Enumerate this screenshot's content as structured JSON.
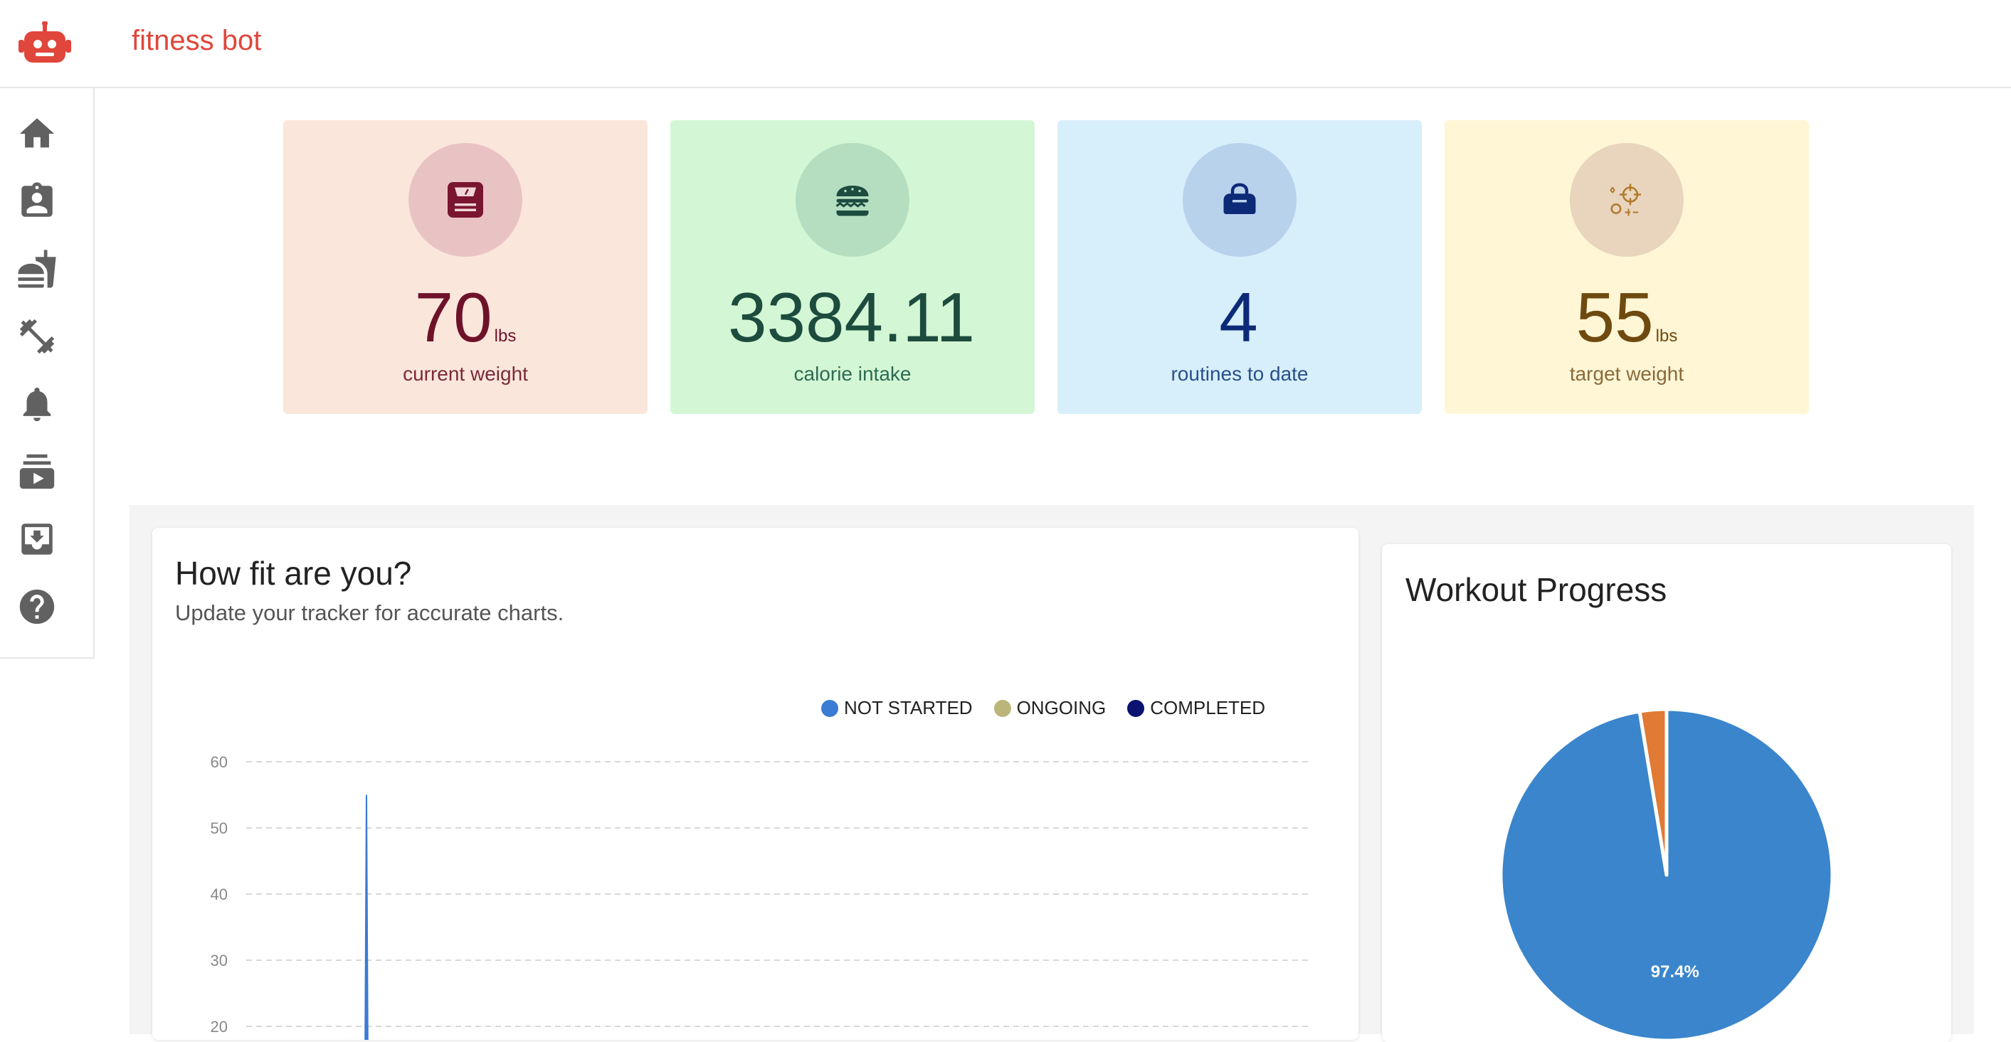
{
  "app": {
    "title": "fitness bot",
    "brand_color": "#e0463b",
    "logo_icon": "robot-icon"
  },
  "sidebar": {
    "items": [
      {
        "icon": "home-icon"
      },
      {
        "icon": "profile-badge-icon"
      },
      {
        "icon": "fastfood-icon"
      },
      {
        "icon": "fitness-dumbbell-icon"
      },
      {
        "icon": "bell-icon"
      },
      {
        "icon": "subscriptions-video-icon"
      },
      {
        "icon": "download-inbox-icon"
      },
      {
        "icon": "help-icon"
      }
    ]
  },
  "stats": [
    {
      "value": "70",
      "unit": "lbs",
      "label": "current weight",
      "icon": "weight-scale-icon",
      "bg": "#fbe6dc",
      "circle": "#e9c3c3",
      "color": "#6e1229"
    },
    {
      "value": "3384.11",
      "unit": "",
      "label": "calorie intake",
      "icon": "burger-icon",
      "bg": "#d3f7d4",
      "circle": "#b5dec1",
      "color": "#1d4b3e"
    },
    {
      "value": "4",
      "unit": "",
      "label": "routines to date",
      "icon": "gym-bag-icon",
      "bg": "#d7effb",
      "circle": "#b9d2ec",
      "color": "#0d2a78"
    },
    {
      "value": "55",
      "unit": "lbs",
      "label": "target weight",
      "icon": "target-scale-icon",
      "bg": "#fff6d5",
      "circle": "#e9d5bd",
      "color": "#6e4a10"
    }
  ],
  "fitness_chart": {
    "title": "How fit are you?",
    "subtitle": "Update your tracker for accurate charts.",
    "legend": [
      {
        "label": "NOT STARTED",
        "color": "#3a7bd5"
      },
      {
        "label": "ONGOING",
        "color": "#bcb57a"
      },
      {
        "label": "COMPLETED",
        "color": "#0b1270"
      }
    ]
  },
  "workout_chart": {
    "title": "Workout Progress"
  },
  "chart_data": [
    {
      "type": "line",
      "title": "How fit are you?",
      "subtitle": "Update your tracker for accurate charts.",
      "xlabel": "",
      "ylabel": "",
      "ylim": [
        20,
        60
      ],
      "yticks": [
        "60",
        "50",
        "40",
        "30",
        "20"
      ],
      "grid": true,
      "legend_position": "top-right",
      "series": [
        {
          "name": "NOT STARTED",
          "color": "#3a7bd5",
          "spike_peak": 55
        }
      ]
    },
    {
      "type": "pie",
      "title": "Workout Progress",
      "slices": [
        {
          "value": 97.4,
          "label": "97.4%",
          "color": "#3a85cc"
        },
        {
          "value": 2.6,
          "label": "",
          "color": "#e07a35"
        }
      ]
    }
  ]
}
